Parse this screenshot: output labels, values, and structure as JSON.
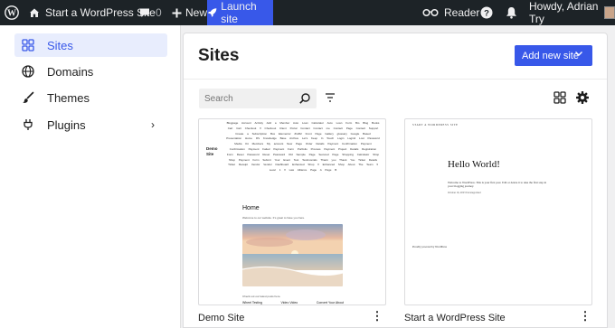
{
  "adminbar": {
    "site_title": "Start a WordPress Site",
    "comment_count": "0",
    "new_label": "New",
    "launch_label": "Launch site",
    "reader_label": "Reader",
    "howdy_label": "Howdy, Adrian Try"
  },
  "sidebar": {
    "items": [
      {
        "label": "Sites",
        "icon": "grid-icon",
        "active": true
      },
      {
        "label": "Domains",
        "icon": "globe-icon"
      },
      {
        "label": "Themes",
        "icon": "brush-icon"
      },
      {
        "label": "Plugins",
        "icon": "plug-icon"
      }
    ]
  },
  "main": {
    "title": "Sites",
    "add_button": "Add new site",
    "search_placeholder": "Search"
  },
  "sites": [
    {
      "name": "Demo Site",
      "preview": {
        "site_title": "Demo Site",
        "menu": "Blogpage Account Activity Add a Member Auto Loan Calculator Auto Loan Form Bio Blog Books Cart Cart Checkout ▾ Checkout Client Portal Contact Contact me Contact Page Contact Support Create a Subscription Box Elementor #1262 Front Page Gallery glossary Google Based Presentation Home IPs Knowledge Base Archive Let's Keep In Touch Login Login2 Lost Password Media Kit Members My account New Page Order Details Payment Confirmation Payment Confirmation Payment Failed Payment Form Portfolio Process Payment Project Details Registration Form Reset Password Reset Password Old Sample Page Secured Page Shopping Calculator Shop Shop Payment Form Submit Your Event Test Testimonials Thank you Thank You Ticket Details Ticket Receipt Vendor Vendor Dashboard Enhanced Shop ▾ Enhanced Shop About The Team ▾ Level 1 ▾ Law Alliance Page A Page B",
        "home": "Home",
        "welcome": "Welcome to our website. It's great to have you here.",
        "latest": "Check out our latest posts here.",
        "posts": [
          "Wheel Testing",
          "Video Video",
          "Convert Your About"
        ]
      }
    },
    {
      "name": "Start a WordPress Site",
      "preview": {
        "site_name": "START A WORDPRESS SITE",
        "heading": "Hello World!",
        "body": "Welcome to WordPress. This is your first post. Edit or delete it to take the first step in your blogging journey.",
        "meta": "October 16, 2023   Uncategorized",
        "footer": "Proudly powered by WordPress"
      }
    }
  ],
  "colors": {
    "admin_bar": "#1d2327",
    "accent": "#3858e9",
    "active_nav_bg": "#e8edfd"
  }
}
